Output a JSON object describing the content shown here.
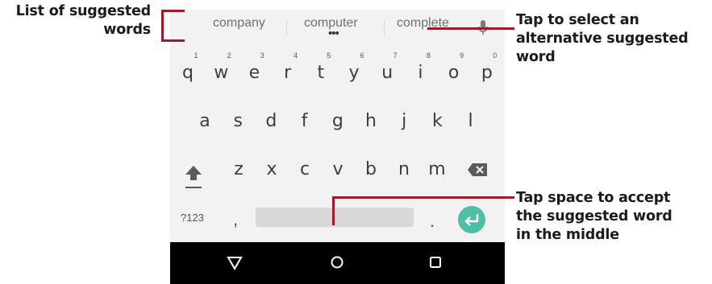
{
  "callouts": {
    "left": {
      "line1": "List of suggested",
      "line2": "words"
    },
    "right_top": {
      "line1": "Tap to select an",
      "line2": "alternative suggested",
      "line3": "word"
    },
    "right_bottom": {
      "line1": "Tap space to accept",
      "line2": "the suggested word",
      "line3": "in the middle"
    }
  },
  "suggestions": [
    "company",
    "computer",
    "complete"
  ],
  "suggestion_more": "•••",
  "keyboard": {
    "row1": [
      {
        "num": "1",
        "letter": "q"
      },
      {
        "num": "2",
        "letter": "w"
      },
      {
        "num": "3",
        "letter": "e"
      },
      {
        "num": "4",
        "letter": "r"
      },
      {
        "num": "5",
        "letter": "t"
      },
      {
        "num": "6",
        "letter": "y"
      },
      {
        "num": "7",
        "letter": "u"
      },
      {
        "num": "8",
        "letter": "i"
      },
      {
        "num": "9",
        "letter": "o"
      },
      {
        "num": "0",
        "letter": "p"
      }
    ],
    "row2": [
      "a",
      "s",
      "d",
      "f",
      "g",
      "h",
      "j",
      "k",
      "l"
    ],
    "row3": [
      "z",
      "x",
      "c",
      "v",
      "b",
      "n",
      "m"
    ],
    "symbols_label": "?123",
    "comma": ",",
    "period": "."
  },
  "icons": {
    "mic": "microphone-icon",
    "shift": "shift-arrow-icon",
    "backspace": "backspace-icon",
    "enter": "enter-arrow-icon",
    "back": "triangle-back-icon",
    "home": "circle-home-icon",
    "recents": "square-recents-icon"
  },
  "colors": {
    "callout_line": "#a01a2a",
    "enter_key": "#4ebfa4",
    "keyboard_bg": "#f2f2f2",
    "navbar_bg": "#000000"
  }
}
